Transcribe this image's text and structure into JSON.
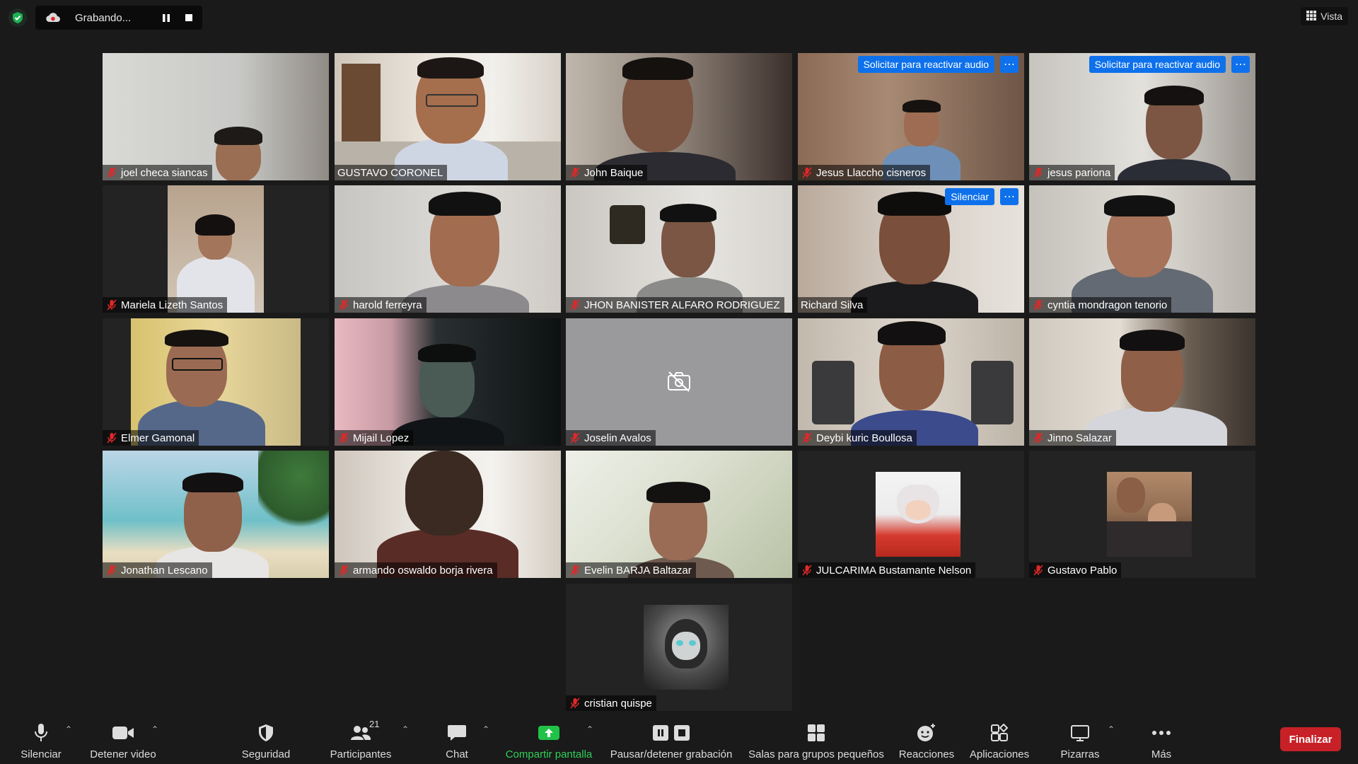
{
  "recording": {
    "status_text": "Grabando..."
  },
  "view_button": {
    "label": "Vista"
  },
  "participants": [
    {
      "name": "joel checa siancas"
    },
    {
      "name": "GUSTAVO CORONEL"
    },
    {
      "name": "John Baique"
    },
    {
      "name": "Jesus Llaccho cisneros",
      "action_label": "Solicitar para reactivar audio"
    },
    {
      "name": "jesus pariona",
      "action_label": "Solicitar para reactivar audio"
    },
    {
      "name": "Mariela Lizeth Santos"
    },
    {
      "name": "harold ferreyra"
    },
    {
      "name": "JHON BANISTER ALFARO RODRIGUEZ"
    },
    {
      "name": "Richard Silva",
      "action_label": "Silenciar"
    },
    {
      "name": "cyntia mondragon tenorio"
    },
    {
      "name": "Elmer Gamonal"
    },
    {
      "name": "Mijail Lopez"
    },
    {
      "name": "Joselin Avalos"
    },
    {
      "name": "Deybi kuric Boullosa"
    },
    {
      "name": "Jinno Salazar"
    },
    {
      "name": "Jonathan Lescano"
    },
    {
      "name": "armando oswaldo borja rivera"
    },
    {
      "name": "Evelin BARJA  Baltazar"
    },
    {
      "name": "JULCARIMA Bustamante Nelson"
    },
    {
      "name": "Gustavo Pablo"
    },
    {
      "name": "cristian quispe"
    }
  ],
  "toolbar": {
    "mute": "Silenciar",
    "video": "Detener video",
    "security": "Seguridad",
    "participants": "Participantes",
    "participants_count": "21",
    "chat": "Chat",
    "share": "Compartir pantalla",
    "recording": "Pausar/detener grabación",
    "breakout": "Salas para grupos pequeños",
    "reactions": "Reacciones",
    "apps": "Aplicaciones",
    "whiteboards": "Pizarras",
    "more": "Más",
    "end": "Finalizar"
  },
  "icons": [
    "shield-check-icon",
    "cloud-record-icon",
    "pause-icon",
    "stop-icon",
    "grid-view-icon",
    "mic-off-icon",
    "more-icon",
    "camera-off-icon",
    "mic-icon",
    "video-icon",
    "shield-icon",
    "participants-icon",
    "chat-icon",
    "share-screen-icon",
    "breakout-icon",
    "reactions-icon",
    "apps-icon",
    "whiteboard-icon",
    "ellipsis-icon",
    "caret-up-icon"
  ],
  "colors": {
    "accent": "#0e71eb",
    "active_speaker": "#d5e254",
    "share_green": "#2fd058",
    "end_red": "#c72127",
    "background": "#1a1a1a"
  }
}
